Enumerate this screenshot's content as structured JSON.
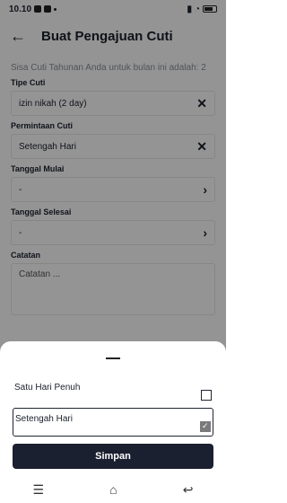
{
  "status": {
    "time": "10.10"
  },
  "header": {
    "title": "Buat Pengajuan Cuti"
  },
  "form": {
    "remaining_text": "Sisa Cuti Tahunan Anda untuk bulan ini adalah: 2",
    "leave_type_label": "Tipe Cuti",
    "leave_type_value": "izin nikah (2 day)",
    "request_label": "Permintaan Cuti",
    "request_value": "Setengah Hari",
    "start_label": "Tanggal Mulai",
    "start_value": "-",
    "end_label": "Tanggal Selesai",
    "end_value": "-",
    "notes_label": "Catatan",
    "notes_placeholder": "Catatan ..."
  },
  "sheet": {
    "options": [
      "Satu Hari Penuh",
      "Setengah Hari"
    ],
    "selected": "Setengah Hari",
    "save_label": "Simpan"
  },
  "icons": {
    "back": "arrow-left-icon",
    "clear": "close-icon",
    "next": "chevron-right-icon"
  }
}
